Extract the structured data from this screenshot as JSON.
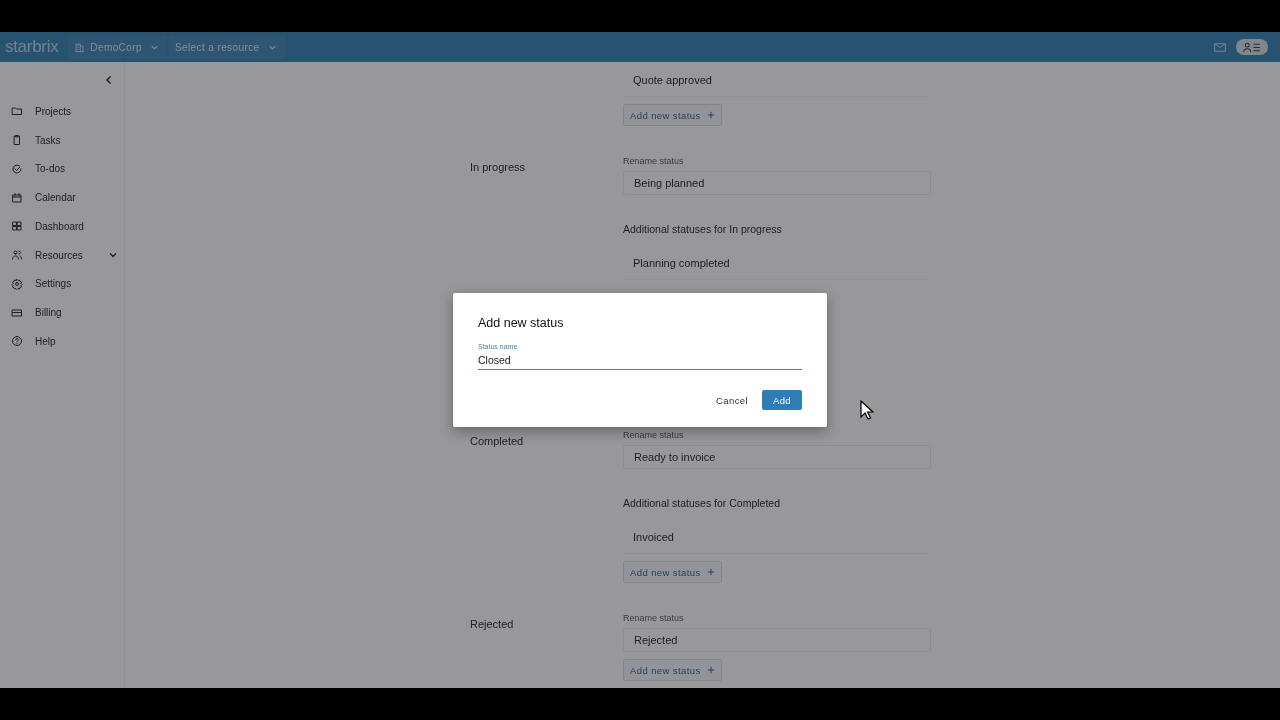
{
  "header": {
    "logo": "starbrix",
    "organization": "DemoCorp",
    "resource_picker": "Select a resource"
  },
  "sidebar": {
    "items": [
      {
        "label": "Projects",
        "kind": "link"
      },
      {
        "label": "Tasks",
        "kind": "link"
      },
      {
        "label": "To-dos",
        "kind": "link"
      },
      {
        "label": "Calendar",
        "kind": "link"
      },
      {
        "label": "Dashboard",
        "kind": "link"
      },
      {
        "label": "Resources",
        "kind": "group",
        "expanded": false
      },
      {
        "label": "Settings",
        "kind": "link"
      },
      {
        "label": "Billing",
        "kind": "link"
      },
      {
        "label": "Help",
        "kind": "link"
      }
    ]
  },
  "sections": [
    {
      "statuses": [
        "Quote approved"
      ],
      "add_button": "Add new status"
    },
    {
      "label": "In progress",
      "rename_label": "Rename status",
      "value": "Being planned",
      "additional_heading": "Additional statuses for In progress",
      "statuses": [
        "Planning completed"
      ]
    },
    {
      "label": "Completed",
      "rename_label": "Rename status",
      "value": "Ready to invoice",
      "additional_heading": "Additional statuses for Completed",
      "statuses": [
        "Invoiced"
      ],
      "add_button": "Add new status"
    },
    {
      "label": "Rejected",
      "rename_label": "Rename status",
      "value": "Rejected",
      "add_button": "Add new status"
    }
  ],
  "dialog": {
    "title": "Add new status",
    "field_label": "Status name",
    "value": "Closed",
    "cancel": "Cancel",
    "confirm": "Add"
  }
}
